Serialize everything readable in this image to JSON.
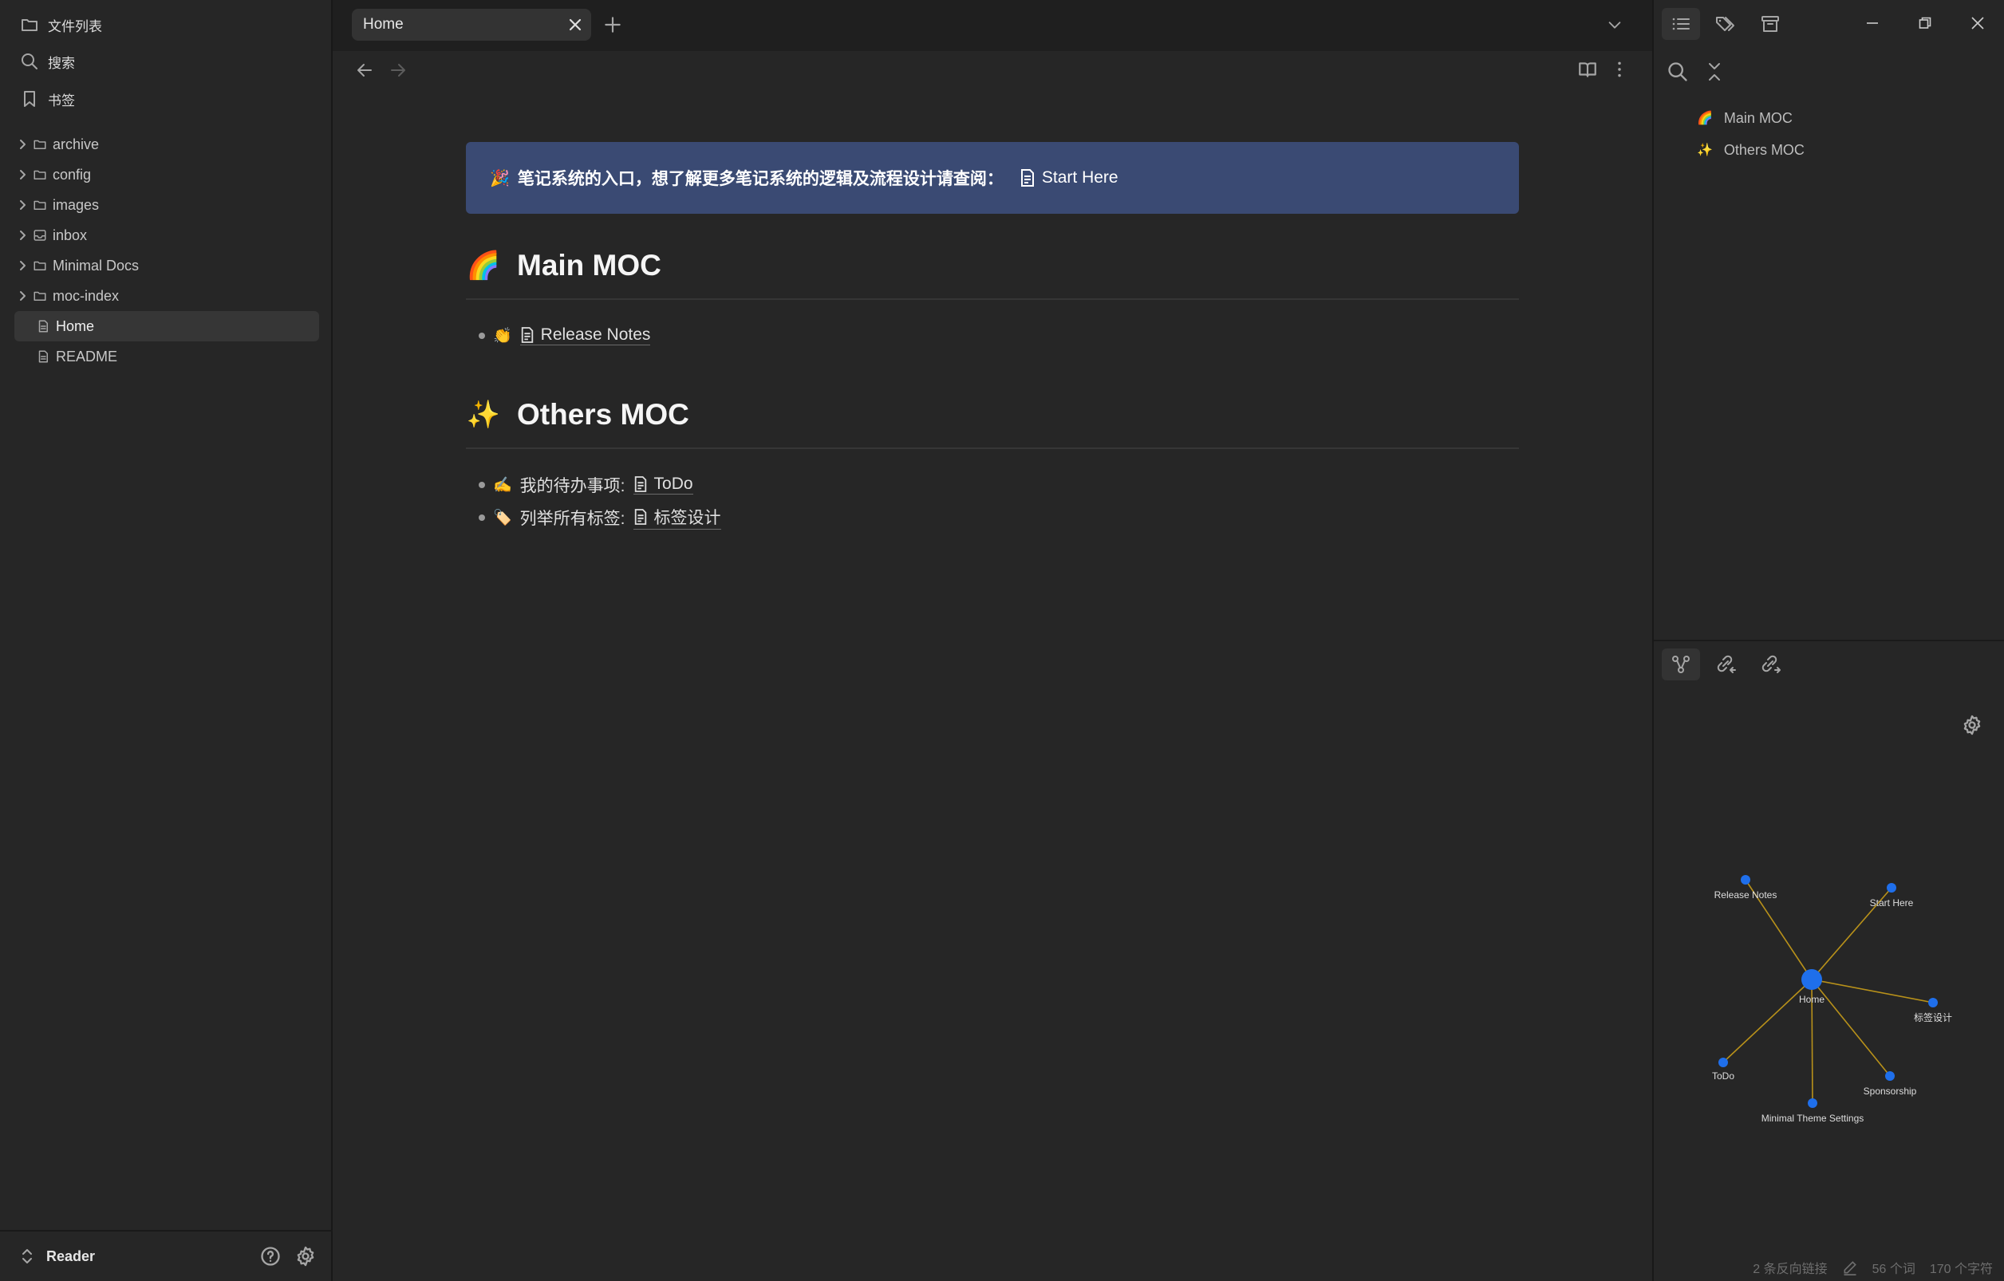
{
  "sidebar": {
    "top_items": [
      {
        "label": "文件列表",
        "icon": "folder-icon"
      },
      {
        "label": "搜索",
        "icon": "search-icon"
      },
      {
        "label": "书签",
        "icon": "bookmark-icon"
      }
    ],
    "tree": [
      {
        "label": "archive",
        "type": "folder"
      },
      {
        "label": "config",
        "type": "folder"
      },
      {
        "label": "images",
        "type": "folder"
      },
      {
        "label": "inbox",
        "type": "folder"
      },
      {
        "label": "Minimal Docs",
        "type": "folder"
      },
      {
        "label": "moc-index",
        "type": "folder"
      },
      {
        "label": "Home",
        "type": "file",
        "active": true
      },
      {
        "label": "README",
        "type": "file"
      }
    ],
    "vault_name": "Reader"
  },
  "tab": {
    "title": "Home"
  },
  "note": {
    "callout": {
      "emoji": "🎉",
      "text": "笔记系统的入口，想了解更多笔记系统的逻辑及流程设计请查阅：",
      "link": "Start Here"
    },
    "sections": [
      {
        "emoji": "🌈",
        "heading": "Main MOC",
        "items": [
          {
            "emoji": "👏",
            "prefix": "",
            "link": "Release Notes"
          }
        ]
      },
      {
        "emoji": "✨",
        "heading": "Others MOC",
        "items": [
          {
            "emoji": "✍️",
            "prefix": "我的待办事项:",
            "link": "ToDo"
          },
          {
            "emoji": "🏷️",
            "prefix": "列举所有标签:",
            "link": "标签设计"
          }
        ]
      }
    ]
  },
  "outline": [
    {
      "emoji": "🌈",
      "label": "Main MOC"
    },
    {
      "emoji": "✨",
      "label": "Others MOC"
    }
  ],
  "graph": {
    "center": "Home",
    "nodes": [
      "Release Notes",
      "Start Here",
      "标签设计",
      "Sponsorship",
      "Minimal Theme Settings",
      "ToDo"
    ],
    "node_color": "#1f6feb",
    "edge_color": "#b8911a"
  },
  "status": {
    "backlinks": "2 条反向链接",
    "words": "56 个词",
    "chars": "170 个字符"
  },
  "colors": {
    "callout_bg": "#3a4a73",
    "accent": "#1f6feb"
  }
}
